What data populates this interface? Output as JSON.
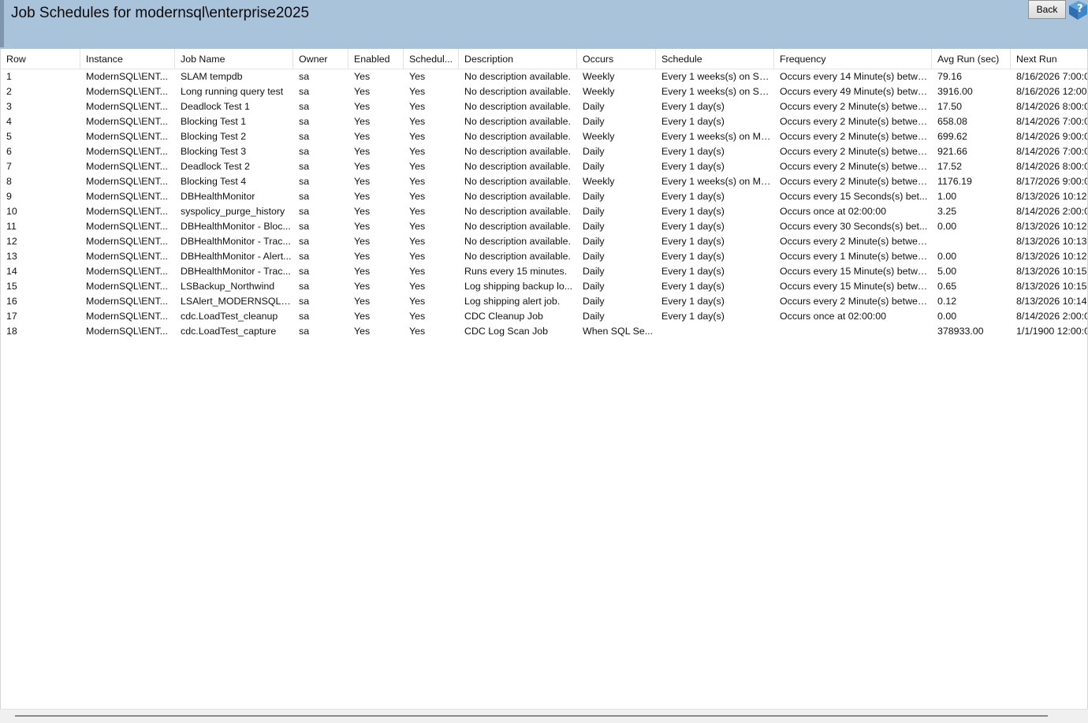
{
  "header": {
    "title": "Job Schedules for modernsql\\enterprise2025",
    "back_label": "Back",
    "help_icon": "help-question-icon",
    "background": "#a9c3da"
  },
  "grid": {
    "columns": [
      "Row",
      "Instance",
      "Job Name",
      "Owner",
      "Enabled",
      "Schedul...",
      "Description",
      "Occurs",
      "Schedule",
      "Frequency",
      "Avg Run (sec)",
      "Next Run"
    ],
    "rows": [
      [
        "1",
        "ModernSQL\\ENT...",
        "SLAM tempdb",
        "sa",
        "Yes",
        "Yes",
        "No description available.",
        "Weekly",
        "Every 1 weeks(s) on Su...",
        "Occurs every 14 Minute(s) betwe...",
        "79.16",
        "8/16/2026 7:00:0"
      ],
      [
        "2",
        "ModernSQL\\ENT...",
        "Long running query test",
        "sa",
        "Yes",
        "Yes",
        "No description available.",
        "Weekly",
        "Every 1 weeks(s) on Su...",
        "Occurs every 49 Minute(s) betwe...",
        "3916.00",
        "8/16/2026 12:00"
      ],
      [
        "3",
        "ModernSQL\\ENT...",
        "Deadlock Test 1",
        "sa",
        "Yes",
        "Yes",
        "No description available.",
        "Daily",
        "Every 1 day(s)",
        "Occurs every 2 Minute(s) betwee...",
        "17.50",
        "8/14/2026 8:00:0"
      ],
      [
        "4",
        "ModernSQL\\ENT...",
        "Blocking Test 1",
        "sa",
        "Yes",
        "Yes",
        "No description available.",
        "Daily",
        "Every 1 day(s)",
        "Occurs every 2 Minute(s) betwee...",
        "658.08",
        "8/14/2026 7:00:0"
      ],
      [
        "5",
        "ModernSQL\\ENT...",
        "Blocking Test 2",
        "sa",
        "Yes",
        "Yes",
        "No description available.",
        "Weekly",
        "Every 1 weeks(s) on Mo...",
        "Occurs every 2 Minute(s) betwee...",
        "699.62",
        "8/14/2026 9:00:0"
      ],
      [
        "6",
        "ModernSQL\\ENT...",
        "Blocking Test 3",
        "sa",
        "Yes",
        "Yes",
        "No description available.",
        "Daily",
        "Every 1 day(s)",
        "Occurs every 2 Minute(s) betwee...",
        "921.66",
        "8/14/2026 7:00:0"
      ],
      [
        "7",
        "ModernSQL\\ENT...",
        "Deadlock Test 2",
        "sa",
        "Yes",
        "Yes",
        "No description available.",
        "Daily",
        "Every 1 day(s)",
        "Occurs every 2 Minute(s) betwee...",
        "17.52",
        "8/14/2026 8:00:0"
      ],
      [
        "8",
        "ModernSQL\\ENT...",
        "Blocking Test 4",
        "sa",
        "Yes",
        "Yes",
        "No description available.",
        "Weekly",
        "Every 1 weeks(s) on Mo...",
        "Occurs every 2 Minute(s) betwee...",
        "1176.19",
        "8/17/2026 9:00:0"
      ],
      [
        "9",
        "ModernSQL\\ENT...",
        "DBHealthMonitor",
        "sa",
        "Yes",
        "Yes",
        "No description available.",
        "Daily",
        "Every 1 day(s)",
        "Occurs every 15 Seconds(s) bet...",
        "1.00",
        "8/13/2026 10:12"
      ],
      [
        "10",
        "ModernSQL\\ENT...",
        "syspolicy_purge_history",
        "sa",
        "Yes",
        "Yes",
        "No description available.",
        "Daily",
        "Every 1 day(s)",
        "Occurs once at 02:00:00",
        "3.25",
        "8/14/2026 2:00:0"
      ],
      [
        "11",
        "ModernSQL\\ENT...",
        "DBHealthMonitor - Bloc...",
        "sa",
        "Yes",
        "Yes",
        "No description available.",
        "Daily",
        "Every 1 day(s)",
        "Occurs every 30 Seconds(s) bet...",
        "0.00",
        "8/13/2026 10:12"
      ],
      [
        "12",
        "ModernSQL\\ENT...",
        "DBHealthMonitor - Trac...",
        "sa",
        "Yes",
        "Yes",
        "No description available.",
        "Daily",
        "Every 1 day(s)",
        "Occurs every 2 Minute(s) betwee...",
        "",
        "8/13/2026 10:13"
      ],
      [
        "13",
        "ModernSQL\\ENT...",
        "DBHealthMonitor - Alert...",
        "sa",
        "Yes",
        "Yes",
        "No description available.",
        "Daily",
        "Every 1 day(s)",
        "Occurs every 1 Minute(s) betwee...",
        "0.00",
        "8/13/2026 10:12"
      ],
      [
        "14",
        "ModernSQL\\ENT...",
        "DBHealthMonitor - Trac...",
        "sa",
        "Yes",
        "Yes",
        "Runs every 15 minutes.",
        "Daily",
        "Every 1 day(s)",
        "Occurs every 15 Minute(s) betwe...",
        "5.00",
        "8/13/2026 10:15"
      ],
      [
        "15",
        "ModernSQL\\ENT...",
        "LSBackup_Northwind",
        "sa",
        "Yes",
        "Yes",
        "Log shipping backup lo...",
        "Daily",
        "Every 1 day(s)",
        "Occurs every 15 Minute(s) betwe...",
        "0.65",
        "8/13/2026 10:15"
      ],
      [
        "16",
        "ModernSQL\\ENT...",
        "LSAlert_MODERNSQL\\...",
        "sa",
        "Yes",
        "Yes",
        "Log shipping alert job.",
        "Daily",
        "Every 1 day(s)",
        "Occurs every 2 Minute(s) betwee...",
        "0.12",
        "8/13/2026 10:14"
      ],
      [
        "17",
        "ModernSQL\\ENT...",
        "cdc.LoadTest_cleanup",
        "sa",
        "Yes",
        "Yes",
        "CDC Cleanup Job",
        "Daily",
        "Every 1 day(s)",
        "Occurs once at 02:00:00",
        "0.00",
        "8/14/2026 2:00:0"
      ],
      [
        "18",
        "ModernSQL\\ENT...",
        "cdc.LoadTest_capture",
        "sa",
        "Yes",
        "Yes",
        "CDC Log Scan Job",
        "When SQL Se...",
        "",
        "",
        "378933.00",
        "1/1/1900 12:00:0"
      ]
    ]
  }
}
